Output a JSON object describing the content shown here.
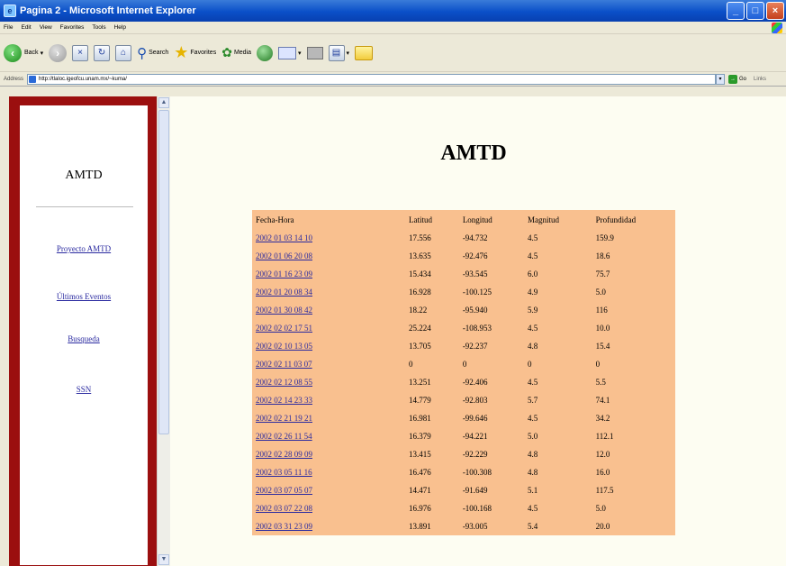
{
  "window": {
    "title": "Pagina 2 - Microsoft Internet Explorer"
  },
  "menu": [
    "File",
    "Edit",
    "View",
    "Favorites",
    "Tools",
    "Help"
  ],
  "toolbar": {
    "back_label": "Back",
    "search_label": "Search",
    "favorites_label": "Favorites",
    "media_label": "Media"
  },
  "address": {
    "label": "Address",
    "url": "http://tlaloc.igeofcu.unam.mx/~kuma/",
    "go_label": "Go",
    "links_label": "Links"
  },
  "sidebar": {
    "title": "AMTD",
    "links": [
      "Proyecto AMTD",
      "Últimos Eventos",
      "Busqueda",
      "SSN"
    ]
  },
  "main": {
    "title": "AMTD",
    "columns": [
      "Fecha-Hora",
      "Latitud",
      "Longitud",
      "Magnitud",
      "Profundidad"
    ],
    "rows": [
      [
        "2002 01 03 14 10",
        "17.556",
        "-94.732",
        "4.5",
        "159.9"
      ],
      [
        "2002 01 06 20 08",
        "13.635",
        "-92.476",
        "4.5",
        "18.6"
      ],
      [
        "2002 01 16 23 09",
        "15.434",
        "-93.545",
        "6.0",
        "75.7"
      ],
      [
        "2002 01 20 08 34",
        "16.928",
        "-100.125",
        "4.9",
        "5.0"
      ],
      [
        "2002 01 30 08 42",
        "18.22",
        "-95.940",
        "5.9",
        "116"
      ],
      [
        "2002 02 02 17 51",
        "25.224",
        "-108.953",
        "4.5",
        "10.0"
      ],
      [
        "2002 02 10 13 05",
        "13.705",
        "-92.237",
        "4.8",
        "15.4"
      ],
      [
        "2002 02 11 03 07",
        "0",
        "0",
        "0",
        "0"
      ],
      [
        "2002 02 12 08 55",
        "13.251",
        "-92.406",
        "4.5",
        "5.5"
      ],
      [
        "2002 02 14 23 33",
        "14.779",
        "-92.803",
        "5.7",
        "74.1"
      ],
      [
        "2002 02 21 19 21",
        "16.981",
        "-99.646",
        "4.5",
        "34.2"
      ],
      [
        "2002 02 26 11 54",
        "16.379",
        "-94.221",
        "5.0",
        "112.1"
      ],
      [
        "2002 02 28 09 09",
        "13.415",
        "-92.229",
        "4.8",
        "12.0"
      ],
      [
        "2002 03 05 11 16",
        "16.476",
        "-100.308",
        "4.8",
        "16.0"
      ],
      [
        "2002 03 07 05 07",
        "14.471",
        "-91.649",
        "5.1",
        "117.5"
      ],
      [
        "2002 03 07 22 08",
        "16.976",
        "-100.168",
        "4.5",
        "5.0"
      ],
      [
        "2002 03 31 23 09",
        "13.891",
        "-93.005",
        "5.4",
        "20.0"
      ]
    ]
  }
}
